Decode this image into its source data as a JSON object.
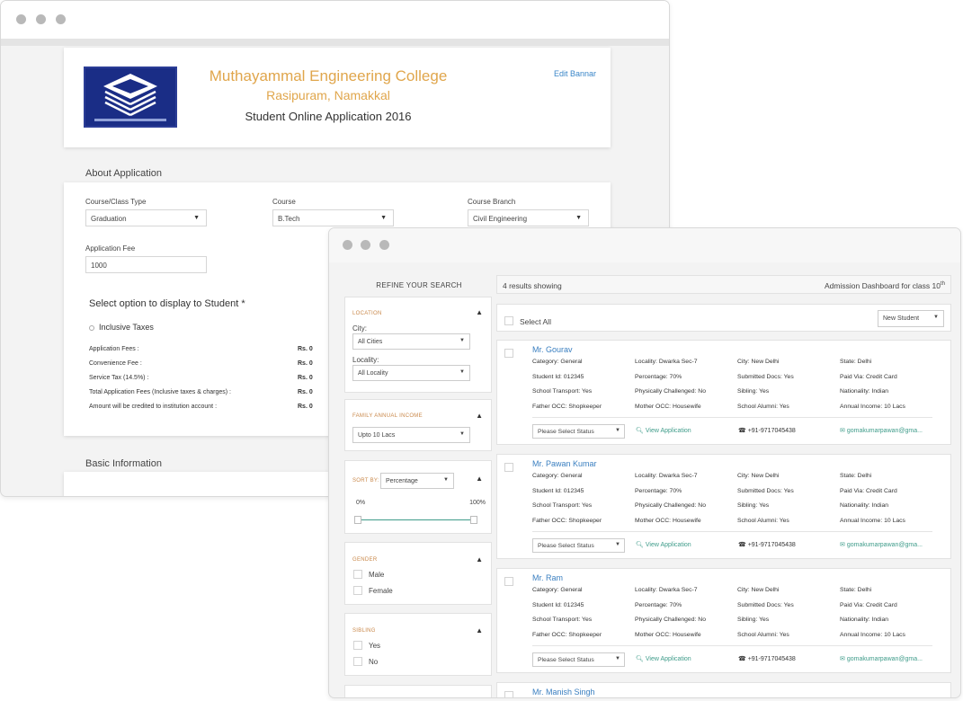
{
  "back": {
    "banner": {
      "college_name": "Muthayammal Engineering College",
      "college_location": "Rasipuram, Namakkal",
      "application_title": "Student Online Application 2016",
      "edit_label": "Edit Bannar"
    },
    "about": {
      "heading": "About Application",
      "course_type_label": "Course/Class Type",
      "course_type_value": "Graduation",
      "course_label": "Course",
      "course_value": "B.Tech",
      "branch_label": "Course Branch",
      "branch_value": "Civil Engineering",
      "fee_label": "Application Fee",
      "fee_value": "1000",
      "option_title": "Select option to display to Student *",
      "radio_label": "Inclusive Taxes",
      "fees": [
        {
          "label": "Application Fees :",
          "amount": "Rs. 0"
        },
        {
          "label": "Convenience Fee :",
          "amount": "Rs. 0"
        },
        {
          "label": "Service Tax (14.5%) :",
          "amount": "Rs. 0"
        },
        {
          "label": "Total Application Fees (Inclusive taxes & charges) :",
          "amount": "Rs. 0"
        },
        {
          "label": "Amount will be credited to institution account :",
          "amount": "Rs. 0"
        }
      ]
    },
    "basic_heading": "Basic Information"
  },
  "front": {
    "refine_title": "REFINE YOUR SEARCH",
    "location": {
      "heading": "LOCATION",
      "city_label": "City:",
      "city_value": "All Cities",
      "locality_label": "Locality:",
      "locality_value": "All Locality"
    },
    "income": {
      "heading": "FAMILY ANNUAL INCOME",
      "value": "Upto 10 Lacs"
    },
    "sort": {
      "label": "SORT BY:",
      "value": "Percentage",
      "min_label": "0%",
      "max_label": "100%"
    },
    "gender": {
      "heading": "GENDER",
      "options": [
        "Male",
        "Female"
      ]
    },
    "sibling": {
      "heading": "SIBLING",
      "options": [
        "Yes",
        "No"
      ]
    },
    "results": {
      "count": "4 results showing",
      "dashboard": "Admission Dashboard for class 10",
      "dashboard_sup": "th",
      "select_all": "Select All",
      "filter_value": "New Student"
    },
    "students": [
      {
        "name": "Mr. Gourav",
        "fields": [
          [
            "Category:",
            "General"
          ],
          [
            "Locality:",
            "Dwarka Sec-7"
          ],
          [
            "City:",
            "New Delhi"
          ],
          [
            "State:",
            "Delhi"
          ],
          [
            "Student Id:",
            "012345"
          ],
          [
            "Percentage:",
            "70%"
          ],
          [
            "Submitted Docs:",
            "Yes"
          ],
          [
            "Paid Via:",
            "Credit Card"
          ],
          [
            "School Transport:",
            "Yes"
          ],
          [
            "Physically Challenged:",
            "No"
          ],
          [
            "Sibling:",
            "Yes"
          ],
          [
            "Nationality:",
            "Indian"
          ],
          [
            "Father OCC:",
            "Shopkeeper"
          ],
          [
            "Mother OCC:",
            "Housewife"
          ],
          [
            "School Alumni:",
            "Yes"
          ],
          [
            "Annual Income:",
            "10 Lacs"
          ]
        ],
        "status": "Please Select Status",
        "view": "View Application",
        "phone": "+91-9717045438",
        "email": "gomakumarpawan@gma..."
      },
      {
        "name": "Mr. Pawan Kumar",
        "fields": [
          [
            "Category:",
            "General"
          ],
          [
            "Locality:",
            "Dwarka Sec-7"
          ],
          [
            "City:",
            "New Delhi"
          ],
          [
            "State:",
            "Delhi"
          ],
          [
            "Student Id:",
            "012345"
          ],
          [
            "Percentage:",
            "70%"
          ],
          [
            "Submitted Docs:",
            "Yes"
          ],
          [
            "Paid Via:",
            "Credit Card"
          ],
          [
            "School Transport:",
            "Yes"
          ],
          [
            "Physically Challenged:",
            "No"
          ],
          [
            "Sibling:",
            "Yes"
          ],
          [
            "Nationality:",
            "Indian"
          ],
          [
            "Father OCC:",
            "Shopkeeper"
          ],
          [
            "Mother OCC:",
            "Housewife"
          ],
          [
            "School Alumni:",
            "Yes"
          ],
          [
            "Annual Income:",
            "10 Lacs"
          ]
        ],
        "status": "Please Select Status",
        "view": "View Application",
        "phone": "+91-9717045438",
        "email": "gomakumarpawan@gma..."
      },
      {
        "name": "Mr. Ram",
        "fields": [
          [
            "Category:",
            "General"
          ],
          [
            "Locality:",
            "Dwarka Sec-7"
          ],
          [
            "City:",
            "New Delhi"
          ],
          [
            "State:",
            "Delhi"
          ],
          [
            "Student Id:",
            "012345"
          ],
          [
            "Percentage:",
            "70%"
          ],
          [
            "Submitted Docs:",
            "Yes"
          ],
          [
            "Paid Via:",
            "Credit Card"
          ],
          [
            "School Transport:",
            "Yes"
          ],
          [
            "Physically Challenged:",
            "No"
          ],
          [
            "Sibling:",
            "Yes"
          ],
          [
            "Nationality:",
            "Indian"
          ],
          [
            "Father OCC:",
            "Shopkeeper"
          ],
          [
            "Mother OCC:",
            "Housewife"
          ],
          [
            "School Alumni:",
            "Yes"
          ],
          [
            "Annual Income:",
            "10 Lacs"
          ]
        ],
        "status": "Please Select Status",
        "view": "View Application",
        "phone": "+91-9717045438",
        "email": "gomakumarpawan@gma..."
      },
      {
        "name": "Mr. Manish Singh"
      }
    ]
  }
}
